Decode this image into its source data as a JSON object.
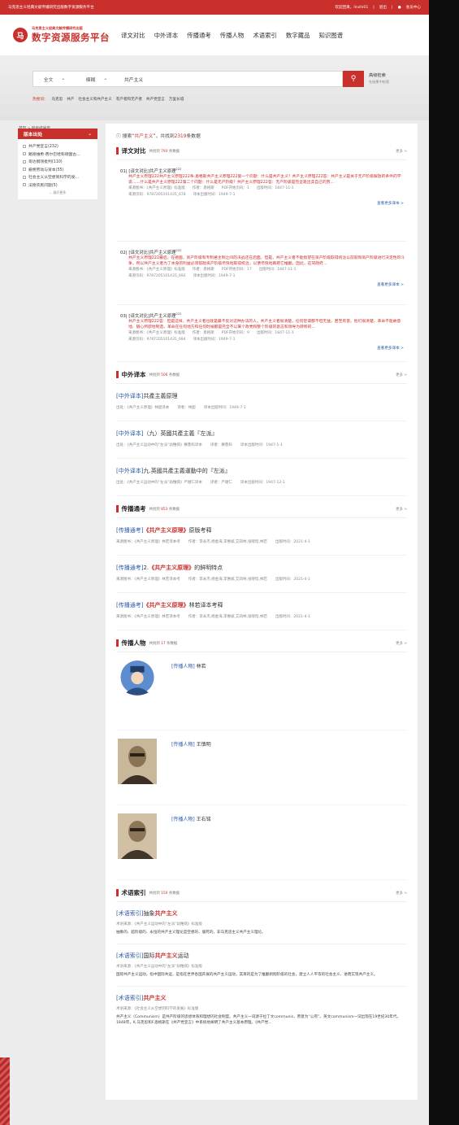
{
  "topbar": {
    "left": "马克思主义经典文献传播研究出版数字资源服务平台",
    "welcome": "欢迎回来，linshi01",
    "logout": "退出",
    "member": "会员中心"
  },
  "logo": {
    "line1": "马克思主义经典文献传播研究出版",
    "line2": "数字资源服务平台",
    "mark": "马"
  },
  "nav": [
    "译文对比",
    "中外译本",
    "传播通考",
    "传播人物",
    "术语索引",
    "数字藏品",
    "知识图谱"
  ],
  "search": {
    "scope": "全文",
    "mode": "模糊",
    "query": "共产主义",
    "btn_icon": "search-icon",
    "adv": "高级检索",
    "adv_sub": "在结果中检索"
  },
  "hot": {
    "label": "热搜词：",
    "items": [
      "马克思",
      "共产",
      "社会主义和共产主义",
      "有产者和无产者",
      "共产党宣言",
      "万里长城"
    ]
  },
  "crumb": "首页 > 检索结果页",
  "side": {
    "head": "版本出处",
    "items": [
      "共产党宣言(232)",
      "路德维希·费尔巴哈和德国古...",
      "哥达纲领批判(110)",
      "雇佣劳动与资本(55)",
      "社会主义从空想到科学的发...",
      "法德农民问题(5)"
    ],
    "more": "展开更多"
  },
  "result": {
    "p1": "搜索“",
    "kw": "共产主义",
    "p2": "”，共找到",
    "n": "2319",
    "p3": "条数据"
  },
  "sec1": {
    "title": "译文对比",
    "cnt_pre": "共找到",
    "cnt": "793",
    "cnt_post": "条数据",
    "more": "更多 >",
    "items": [
      {
        "no": "01",
        "head": "[译文对比]共产主义原理",
        "sup": "222",
        "text": "共产主义原理222共产主义原理222条·恩格斯共产主义原理222第一个问题：什么是共产主义？共产主义原理222答：共产主义是关于无产阶级解放的条件的学说……什么是共产主义原理222第二个问题：什么是无产阶级？共产主义原理222答：无产阶级是完全靠出卖自己的劳...",
        "meta1": [
          "来源图书：《共产主义原理》标准版",
          "作者：恩格斯",
          "PDF开始页码：1",
          "出版时间：1847-11-1"
        ],
        "meta2": [
          "来源页码：9787205101435_678",
          "译本出版时间：1949-7-1"
        ],
        "see": "查看更多译本 >"
      },
      {
        "no": "02",
        "head": "[译文对比]共产主义原理",
        "sup": "222",
        "text": "共产主义原理222最后，在德国，资产阶级和专制君主制之间的决战还在后面。但是，共产主义者不能指望在资产阶级取得统治以前就和资产阶级进行决定性的斗争，所以共产主义者为了本身的利益必须帮助资产阶级尽快地取得统治，以便尽快地再把它推翻。因此，在同政府...",
        "meta1": [
          "来源图书：《共产主义原理》标准版",
          "作者：恩格斯",
          "PDF开始页码：17",
          "出版时间：1847-11-1"
        ],
        "meta2": [
          "来源页码：9787205101435_692",
          "译本出版时间：1949-7-1"
        ],
        "see": "查看更多译本 >"
      },
      {
        "no": "03",
        "head": "[译文对比]共产主义原理",
        "sup": "222",
        "text": "共产主义原理222答：但是这样，共产主义者也就是最不反对这种办法的人。共产主义者很清楚，任何密谋都不但无益，甚至有害。他们很清楚，革命不能故意地、随心所欲地制造，革命在任何地方和任何时候都是完全不以某个政党和整个阶级的意志和领导为转移的...",
        "meta1": [
          "来源图书：《共产主义原理》标准版",
          "作者：恩格斯",
          "PDF开始页码：9",
          "出版时间：1847-11-1"
        ],
        "meta2": [
          "来源页码：9787205101435_684",
          "译本出版时间：1949-7-1"
        ],
        "see": "查看更多译本 >"
      }
    ]
  },
  "sec2": {
    "title": "中外译本",
    "cnt_pre": "共找到",
    "cnt": "506",
    "cnt_post": "条数据",
    "more": "更多 >",
    "items": [
      {
        "pre": "[中外译本]",
        "title": "共產主義原理",
        "meta": [
          "出处：《共产主义原理》林超译本",
          "译者：林超",
          "译本出版时间：1949-7-1"
        ]
      },
      {
        "pre": "[中外译本]",
        "title": "（九）英國共產主義『左派』",
        "meta": [
          "出处：《共产主义运动中的“左派”幼稚病》赛鲁科译本",
          "译者：赛鲁科",
          "译本出版时间：1947-1-1"
        ]
      },
      {
        "pre": "[中外译本]",
        "title": "九.英國共產主義運動中的『左派』",
        "meta": [
          "出处：《共产主义运动中的“左派”幼稚病》严顺仁译本",
          "译者：严顺仁",
          "译本出版时间：1947-12-1"
        ]
      }
    ]
  },
  "sec3": {
    "title": "传播通考",
    "cnt_pre": "共找到",
    "cnt": "853",
    "cnt_post": "条数据",
    "more": "更多 >",
    "items": [
      {
        "pre": "[传播通考]",
        "red": "《共产主义原理》",
        "title": "原版考释",
        "meta": [
          "来源图书：《共产主义原理》林若译本考",
          "作者：李永杰,杨金海,李惠斌,艾四林,张晓晗,林若",
          "出版时间：2021-4-1"
        ]
      },
      {
        "pre": "[传播通考]",
        "num": "2.",
        "red": "《共产主义原理》",
        "title": "的鲜明特点",
        "meta": [
          "来源图书：《共产主义原理》林若译本考",
          "作者：李永杰,杨金海,李惠斌,艾四林,张晓晗,林若",
          "出版时间：2021-4-1"
        ]
      },
      {
        "pre": "[传播通考]",
        "red": "《共产主义原理》",
        "title": "林若译本考释",
        "meta": [
          "来源图书：《共产主义原理》林若译本考",
          "作者：李永杰,杨金海,李惠斌,艾四林,张晓晗,林若",
          "出版时间：2021-4-1"
        ]
      }
    ]
  },
  "sec4": {
    "title": "传播人物",
    "cnt_pre": "共找到",
    "cnt": "17",
    "cnt_post": "条数据",
    "more": "更多 >",
    "items": [
      {
        "pre": "[传播人物]",
        "name": "林若"
      },
      {
        "pre": "[传播人物]",
        "name": "王慎明"
      },
      {
        "pre": "[传播人物]",
        "name": "王右铭"
      }
    ]
  },
  "sec5": {
    "title": "术语索引",
    "cnt_pre": "共找到",
    "cnt": "150",
    "cnt_post": "条数据",
    "more": "更多 >",
    "items": [
      {
        "pre": "[术语索引]",
        "pre2": "抽象",
        "red": "共产主义",
        "post": "",
        "src": "术语来源：《共产主义运动中的“左派”幼稚病》标准版",
        "def": "抽象的、超阶级的、永恒的共产主义理论是空想的、僵死的，非马克思主义共产主义理论。"
      },
      {
        "pre": "[术语索引]",
        "pre2": "国际",
        "red": "共产主义",
        "post": "运动",
        "src": "术语来源：《共产主义运动中的“左派”幼稚病》标准版",
        "def": "国际共产主义运动，指中国际共运，是指在世界各国开展的共产主义运动，其目的是为了推翻剥削阶级的社会，建立人人平等的社会主义、进而实现共产主义。"
      },
      {
        "pre": "[术语索引]",
        "pre2": "",
        "red": "共产主义",
        "post": "",
        "src": "术语来源：《社会主义从空想到科学的发展》标准版",
        "def": "共产主义（Communism）是共产阶级的思想体系和理想的社会制度。共产主义一词源于拉丁文communis，原意为“公有”。英文communism一词出现在19世纪30年代。1848年，K.马克思和F.恩格斯在《共产党宣言》中系统地阐明了共产主义基本原理。《共产党..."
      }
    ]
  }
}
